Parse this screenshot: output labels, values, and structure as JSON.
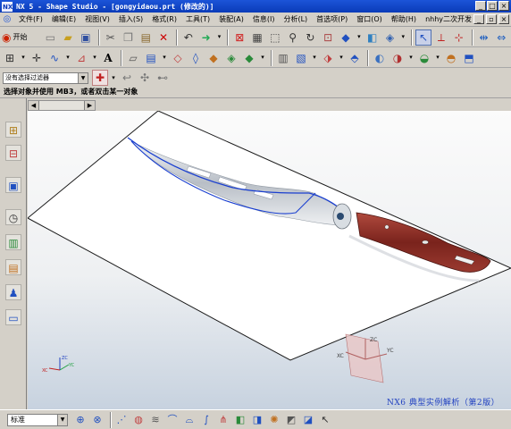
{
  "window": {
    "title": "NX 5 - Shape Studio - [gongyidaou.prt (修改的)]",
    "app_icon_label": "NX"
  },
  "menu": {
    "items": [
      "文件(F)",
      "编辑(E)",
      "视图(V)",
      "插入(S)",
      "格式(R)",
      "工具(T)",
      "装配(A)",
      "信息(I)",
      "分析(L)",
      "首选项(P)",
      "窗口(O)",
      "帮助(H)",
      "nhhy二次开发"
    ]
  },
  "toolbar": {
    "start_label": "开始"
  },
  "selection": {
    "filter_value": "没有选择过滤器",
    "cue": "选择对象并使用 MB3，或者双击某一对象"
  },
  "status": {
    "mode_value": "标准"
  },
  "watermark": {
    "text": "NX6 典型实例解析（第2版）"
  },
  "triad": {
    "x_label": "XC",
    "y_label": "YC",
    "z_label": "ZC"
  },
  "colors": {
    "title_blue": "#0a3bb8",
    "handle_red": "#8b2a22",
    "outline_blue": "#1a3fd0"
  }
}
